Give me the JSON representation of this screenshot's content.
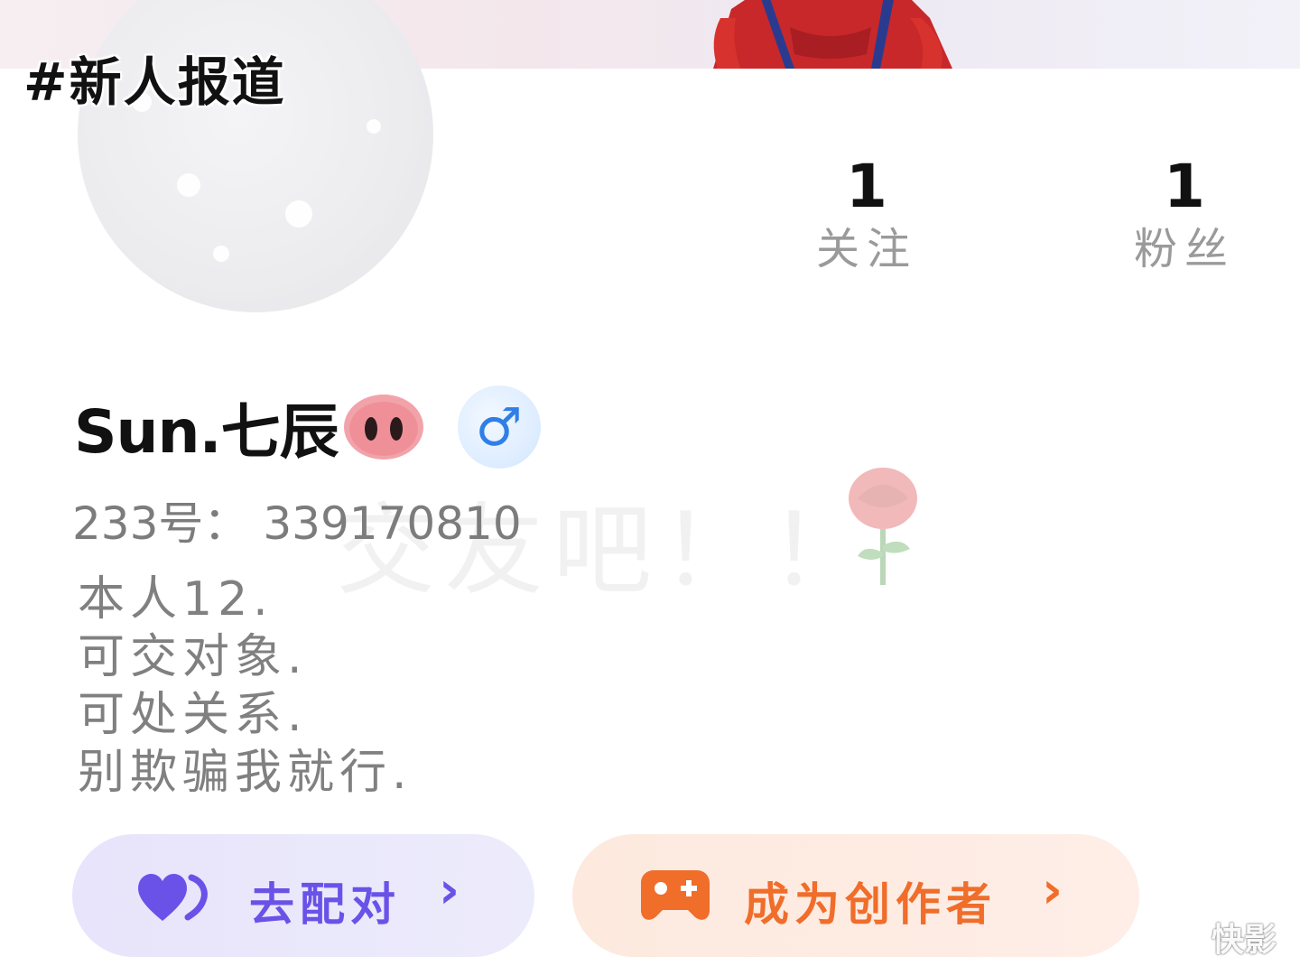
{
  "overlay": {
    "tag_text": "#新人报道"
  },
  "stats": [
    {
      "count": "1",
      "label": "关注"
    },
    {
      "count": "1",
      "label": "粉丝"
    }
  ],
  "profile": {
    "username": "Sun.七辰",
    "gender_symbol": "♂",
    "uid_line": "233号： 339170810",
    "bio_lines": [
      "本人12.",
      "可交对象.",
      "可处关系.",
      "别欺骗我就行."
    ],
    "watermark_text": "交友吧！！"
  },
  "actions": {
    "match_label": "去配对",
    "match_chevron": "›",
    "creator_label": "成为创作者",
    "creator_chevron": "›"
  },
  "watermark_brand": {
    "text": "快影"
  },
  "colors": {
    "match_accent": "#6a52e8",
    "creator_accent": "#f06d2a",
    "gender_blue": "#2f7fe6",
    "pig_pink": "#f2a3aa"
  },
  "icons": {
    "pig": "pig-nose-icon",
    "gender": "male-icon",
    "match": "heart-icon",
    "creator": "gamepad-icon",
    "brand": "camera-logo-icon"
  }
}
